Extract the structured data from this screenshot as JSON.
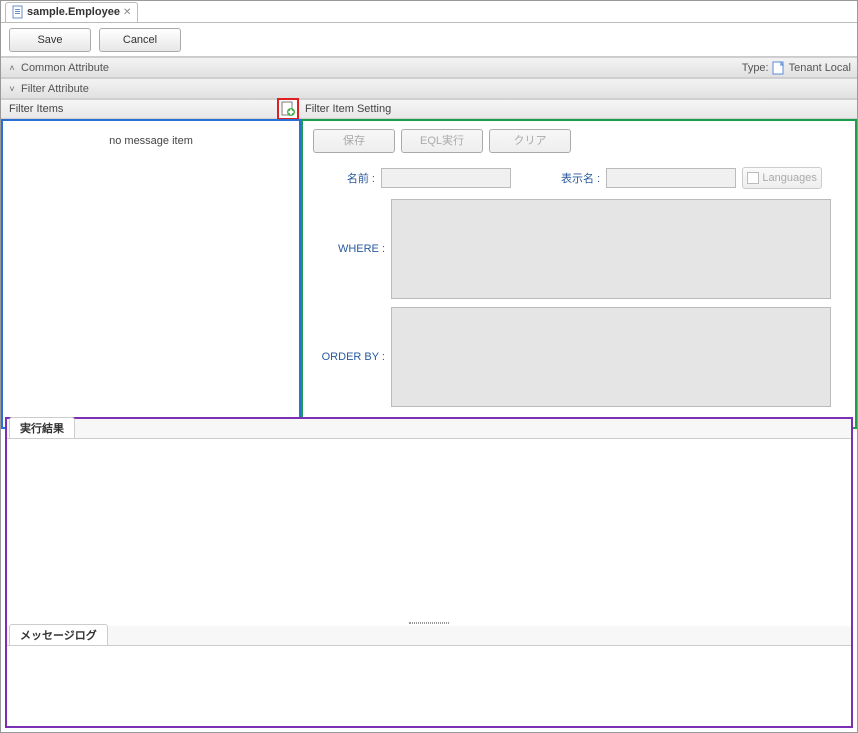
{
  "tab": {
    "title": "sample.Employee"
  },
  "toolbar": {
    "save": "Save",
    "cancel": "Cancel"
  },
  "sections": {
    "common": "Common Attribute",
    "filter": "Filter Attribute",
    "type_label": "Type:",
    "type_value": "Tenant Local"
  },
  "filter_items": {
    "header": "Filter Items",
    "empty": "no message item"
  },
  "filter_setting": {
    "header": "Filter Item Setting",
    "buttons": {
      "save": "保存",
      "eql": "EQL実行",
      "clear": "クリア"
    },
    "labels": {
      "name": "名前 :",
      "display_name": "表示名 :",
      "where": "WHERE :",
      "order_by": "ORDER BY :",
      "languages": "Languages"
    },
    "values": {
      "name": "",
      "display_name": "",
      "where": "",
      "order_by": ""
    }
  },
  "results": {
    "tab": "実行結果"
  },
  "messages": {
    "tab": "メッセージログ"
  }
}
